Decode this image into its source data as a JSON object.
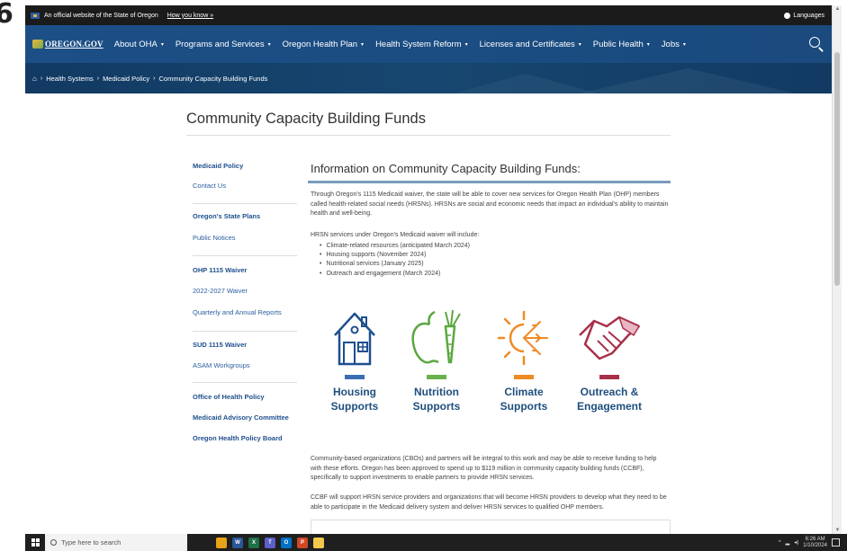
{
  "edge_glyph": "6",
  "gov_banner": {
    "text": "An official website of the State of Oregon",
    "link": "How you know »",
    "languages": "Languages"
  },
  "nav": {
    "logo": "OREGON.GOV",
    "items": [
      {
        "label": "About OHA",
        "has_caret": true
      },
      {
        "label": "Programs and Services",
        "has_caret": true
      },
      {
        "label": "Oregon Health Plan",
        "has_caret": true
      },
      {
        "label": "Health System Reform",
        "has_caret": true
      },
      {
        "label": "Licenses and Certificates",
        "has_caret": true
      },
      {
        "label": "Public Health",
        "has_caret": true
      },
      {
        "label": "Jobs",
        "has_caret": true
      }
    ],
    "caret": "▾",
    "search_icon": "search-icon"
  },
  "breadcrumb": {
    "home_icon": "home-icon",
    "separator": "›",
    "items": [
      "Health Systems",
      "Medicaid Policy",
      "Community Capacity Building Funds"
    ]
  },
  "page_title": "Community Capacity Building Funds",
  "sidebar": {
    "links": [
      {
        "label": "Medicaid Policy",
        "bold": true
      },
      {
        "label": "Contact Us",
        "bold": false
      },
      {
        "label": "Oregon's State Plans",
        "bold": true
      },
      {
        "label": "Public Notices",
        "bold": false
      },
      {
        "label": "OHP 1115 Waiver",
        "bold": true
      },
      {
        "label": "2022-2027 Waiver",
        "bold": false
      },
      {
        "label": "Quarterly and Annual Reports",
        "bold": false
      },
      {
        "label": "SUD 1115 Waiver",
        "bold": true
      },
      {
        "label": "ASAM Workgroups",
        "bold": false
      },
      {
        "label": "Office of Health Policy",
        "bold": true
      },
      {
        "label": "Medicaid Advisory Committee",
        "bold": true
      },
      {
        "label": "Oregon Health Policy Board",
        "bold": true
      }
    ]
  },
  "main": {
    "heading": "Information on Community Capacity Building Funds:",
    "intro": "Through Oregon's 1115 Medicaid waiver, the state will be able to cover new services for Oregon Health Plan (OHP) members called health-related social needs (HRSNs). HRSNs are social and economic needs that impact an individual's ability to maintain health and well-being.",
    "services_intro": "HRSN services under Oregon's Medicaid waiver will include:",
    "services": [
      "Climate-related resources (anticipated March 2024)",
      "Housing supports (November 2024)",
      "Nutritional services (January 2025)",
      "Outreach and engagement (March 2024)"
    ],
    "tiles": [
      {
        "line1": "Housing",
        "line2": "Supports",
        "icon": "house-icon",
        "color": "#3b6db3"
      },
      {
        "line1": "Nutrition",
        "line2": "Supports",
        "icon": "apple-carrot-icon",
        "color": "#6ab04c"
      },
      {
        "line1": "Climate",
        "line2": "Supports",
        "icon": "sun-snowflake-icon",
        "color": "#f08a24"
      },
      {
        "line1": "Outreach &",
        "line2": "Engagement",
        "icon": "handshake-icon",
        "color": "#a8304a"
      }
    ],
    "label_color": "#1f4f7d",
    "para2": "Community-based organizations (CBOs) and partners will be integral to this work and may be able to receive funding to help with these efforts. Oregon has been approved to spend up to $119 million in community capacity building funds (CCBF), specifically to support investments to enable partners to provide HRSN services.",
    "para3": "CCBF will support HRSN service providers and organizations that will become HRSN providers to develop what they need to be able to participate in the Medicaid delivery system and deliver HRSN services to qualified OHP members."
  },
  "taskbar": {
    "search_placeholder": "Type here to search",
    "apps": [
      {
        "icon": "chrome-icon",
        "color": "#e8a317",
        "text": ""
      },
      {
        "icon": "word-icon",
        "color": "#2b5797",
        "text": "W"
      },
      {
        "icon": "excel-icon",
        "color": "#1e7145",
        "text": "X"
      },
      {
        "icon": "teams-icon",
        "color": "#5b5fc7",
        "text": "T"
      },
      {
        "icon": "outlook-icon",
        "color": "#0072c6",
        "text": "O"
      },
      {
        "icon": "powerpoint-icon",
        "color": "#d24726",
        "text": "P"
      },
      {
        "icon": "file-explorer-icon",
        "color": "#f2c94c",
        "text": ""
      }
    ],
    "time": "6:26 AM",
    "date": "1/10/2024"
  },
  "colors": {
    "nav_bg": "#1c4f86",
    "crumb_bg": "#123a63",
    "link": "#2a5f9e",
    "heading_bar": "#7a9bbd"
  }
}
